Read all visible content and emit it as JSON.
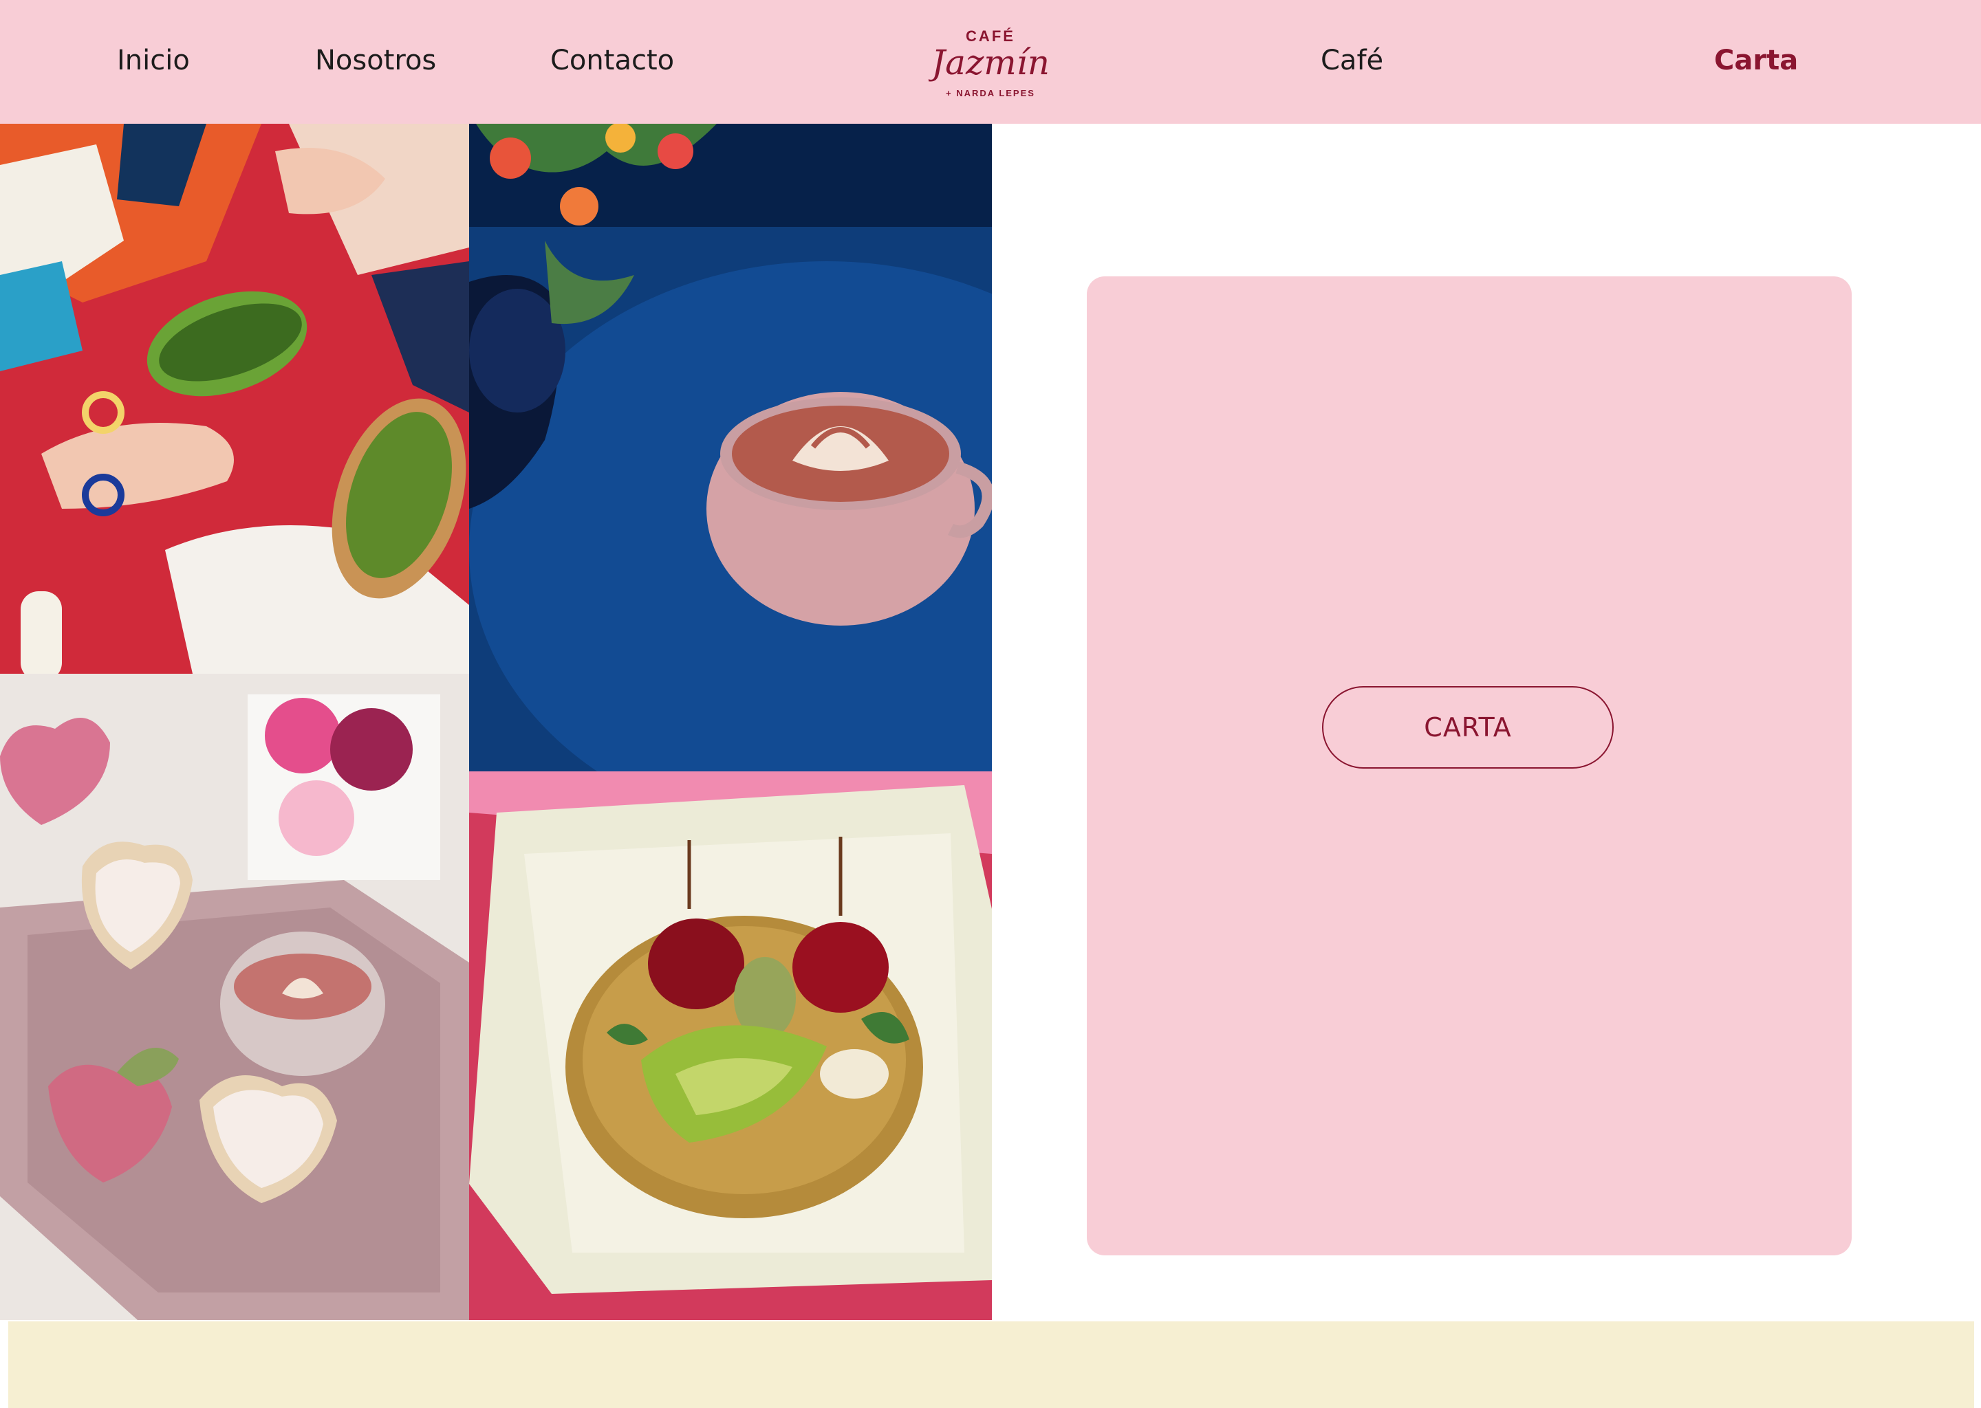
{
  "nav": {
    "left_links": [
      {
        "label": "Inicio"
      },
      {
        "label": "Nosotros"
      },
      {
        "label": "Contacto"
      }
    ],
    "right_links": [
      {
        "label": "Café"
      },
      {
        "label": "Carta",
        "active": true
      }
    ],
    "logo": {
      "top_text": "CAFÉ",
      "script_text": "Jazmín",
      "bottom_text": "+ NARDA LEPES"
    }
  },
  "photos": [
    {
      "name": "avocado-toast",
      "icon": "photo"
    },
    {
      "name": "latte-on-blue-table",
      "icon": "photo"
    },
    {
      "name": "heart-cookies-tray",
      "icon": "photo"
    },
    {
      "name": "cherry-kiwi-tart",
      "icon": "photo"
    }
  ],
  "menu_card": {
    "button_label": "CARTA"
  },
  "colors": {
    "header_bg": "#f8cdd6",
    "card_bg": "#f8cdd6",
    "accent": "#8a1530",
    "footer_bg": "#f6efd2"
  }
}
